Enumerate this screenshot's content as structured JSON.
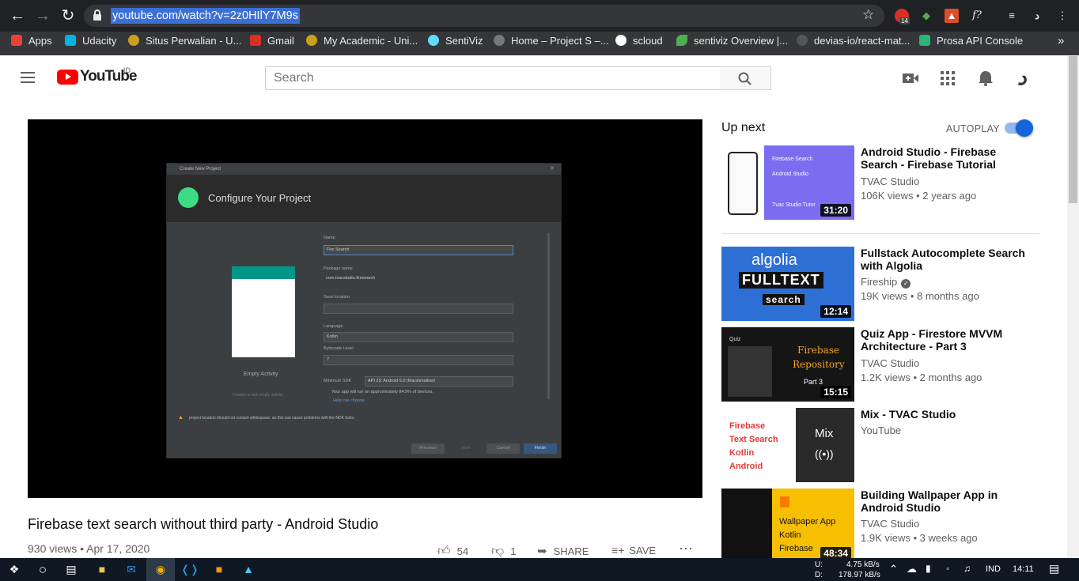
{
  "browser": {
    "url": "youtube.com/watch?v=2z0HIlY7M9s",
    "ext_badge": "14",
    "bookmarks": [
      {
        "label": "Apps",
        "color": "#ea4335"
      },
      {
        "label": "Udacity",
        "color": "#02b3e4"
      },
      {
        "label": "Situs Perwalian - U...",
        "color": "#c8a020"
      },
      {
        "label": "Gmail",
        "color": "#d93025"
      },
      {
        "label": "My Academic - Uni...",
        "color": "#c8a020"
      },
      {
        "label": "SentiViz",
        "color": "#61dafb"
      },
      {
        "label": "Home – Project S –...",
        "color": "#777777"
      },
      {
        "label": "scloud",
        "color": "#ffffff"
      },
      {
        "label": "sentiviz Overview |...",
        "color": "#4caf50"
      },
      {
        "label": "devias-io/react-mat...",
        "color": "#555555"
      },
      {
        "label": "Prosa API Console",
        "color": "#2bb673"
      }
    ],
    "bookmarks_more": "»"
  },
  "youtube": {
    "logo_text": "YouTube",
    "region": "ID",
    "search_placeholder": "Search"
  },
  "video_frame": {
    "dialog_title": "Create New Project",
    "heading": "Configure Your Project",
    "name_label": "Name",
    "name_value": "Fire Search",
    "package_label": "Package name",
    "package_value": "com.tvacstudio.firesearch",
    "save_label": "Save location",
    "language_label": "Language",
    "language_value": "Kotlin",
    "bytecode_label": "Bytecode Level",
    "bytecode_value": "7",
    "minsdk_label": "Minimum SDK",
    "minsdk_value": "API 23: Android 6.0 (Marshmallow)",
    "minsdk_info": "Your app will run on approximately 84.9% of devices.",
    "help": "Help me choose",
    "warning": "project location should not contain whitespace, as this can cause problems with the NDK tools.",
    "activity": "Empty Activity",
    "activity_desc": "Creates a new empty activity",
    "btn_previous": "Previous",
    "btn_next": "Next",
    "btn_cancel": "Cancel",
    "btn_finish": "Finish"
  },
  "video": {
    "title": "Firebase text search without third party - Android Studio",
    "meta": "930 views • Apr 17, 2020",
    "likes": "54",
    "dislikes": "1",
    "share": "SHARE",
    "save": "SAVE"
  },
  "sidebar": {
    "up_next": "Up next",
    "autoplay": "AUTOPLAY",
    "autoplay_on": true,
    "items": [
      {
        "title": "Android Studio - Firebase Search - Firebase Tutorial",
        "channel": "TVAC Studio",
        "views": "106K views • 2 years ago",
        "duration": "31:20",
        "thumb_lines": [
          "Firebase Search",
          "Android Studio",
          "Tvac Studio Tutor"
        ]
      },
      {
        "title": "Fullstack Autocomplete Search with Algolia",
        "channel": "Fireship",
        "verified": true,
        "views": "19K views • 8 months ago",
        "duration": "12:14",
        "thumb_lines": [
          "algolia",
          "FULLTEXT",
          "search"
        ]
      },
      {
        "title": "Quiz App - Firestore MVVM Architecture - Part 3",
        "channel": "TVAC Studio",
        "views": "1.2K views • 2 months ago",
        "duration": "15:15",
        "thumb_lines": [
          "Firebase",
          "Repository",
          "Part 3",
          "Quiz"
        ]
      },
      {
        "title": "Mix - TVAC Studio",
        "channel": "YouTube",
        "views": "",
        "duration": "",
        "thumb_lines": [
          "Firebase",
          "Text Search",
          "Kotlin",
          "Android",
          "Mix"
        ]
      },
      {
        "title": "Building Wallpaper App in Android Studio",
        "channel": "TVAC Studio",
        "views": "1.9K views • 3 weeks ago",
        "duration": "48:34",
        "thumb_lines": [
          "Wallpaper App",
          "Kotlin",
          "Firebase"
        ]
      }
    ]
  },
  "taskbar": {
    "net_up_label": "U:",
    "net_up": "4.75 kB/s",
    "net_down_label": "D:",
    "net_down": "178.97 kB/s",
    "lang": "IND",
    "time": "14:11"
  }
}
